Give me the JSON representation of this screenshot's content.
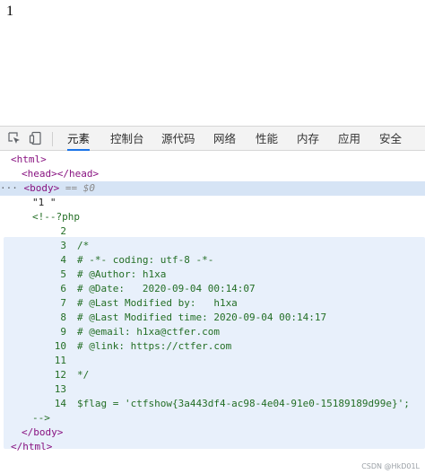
{
  "page": {
    "text": "1"
  },
  "devtools": {
    "icons": [
      "inspect-element-icon",
      "device-toolbar-icon"
    ],
    "tabs": [
      {
        "label": "元素",
        "active": true
      },
      {
        "label": "控制台",
        "active": false
      },
      {
        "label": "源代码",
        "active": false
      },
      {
        "label": "网络",
        "active": false
      },
      {
        "label": "性能",
        "active": false
      },
      {
        "label": "内存",
        "active": false
      },
      {
        "label": "应用",
        "active": false
      },
      {
        "label": "安全",
        "active": false
      }
    ],
    "tree": {
      "html_open": "<html>",
      "head": "<head></head>",
      "body_open": "<body>",
      "body_marker": "== $0",
      "text_node": "\"1 \"",
      "comment_open": "<!--?php",
      "lines": [
        {
          "num": "2",
          "text": ""
        },
        {
          "num": "3",
          "text": "/*"
        },
        {
          "num": "4",
          "text": "# -*- coding: utf-8 -*-"
        },
        {
          "num": "5",
          "text": "# @Author: h1xa"
        },
        {
          "num": "6",
          "text": "# @Date:   2020-09-04 00:14:07"
        },
        {
          "num": "7",
          "text": "# @Last Modified by:   h1xa"
        },
        {
          "num": "8",
          "text": "# @Last Modified time: 2020-09-04 00:14:17"
        },
        {
          "num": "9",
          "text": "# @email: h1xa@ctfer.com"
        },
        {
          "num": "10",
          "text": "# @link: https://ctfer.com"
        },
        {
          "num": "11",
          "text": ""
        },
        {
          "num": "12",
          "text": "*/"
        },
        {
          "num": "13",
          "text": ""
        },
        {
          "num": "14",
          "text": "$flag = 'ctfshow{3a443df4-ac98-4e04-91e0-15189189d99e}';"
        }
      ],
      "comment_close": "-->",
      "body_close": "</body>",
      "html_close": "</html>"
    }
  },
  "watermark": "CSDN @HkD01L"
}
